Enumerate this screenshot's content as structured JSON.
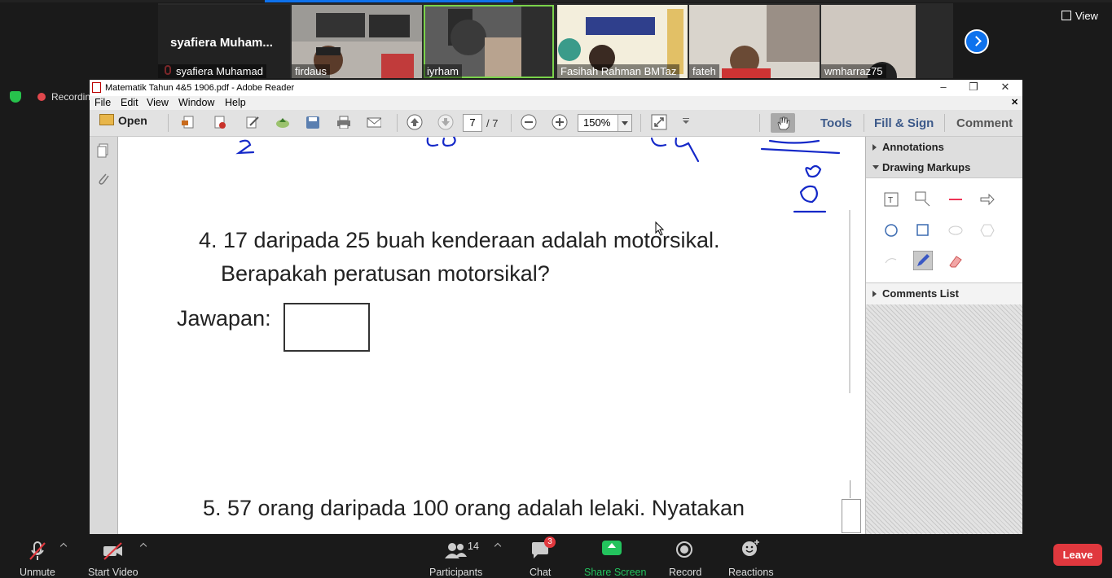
{
  "zoom": {
    "self_name_big": "syafiera  Muham...",
    "participants": [
      {
        "name": "syafiera Muhamad",
        "muted": true
      },
      {
        "name": "firdaus"
      },
      {
        "name": "iyrham",
        "speaking": true
      },
      {
        "name": "Fasihah Rahman BMTaz"
      },
      {
        "name": "fateh"
      },
      {
        "name": "wmharraz75"
      }
    ],
    "view_label": "View",
    "recording_label": "Recording",
    "bottom": {
      "unmute": "Unmute",
      "start_video": "Start Video",
      "participants_label": "Participants",
      "participants_count": "14",
      "chat": "Chat",
      "chat_badge": "3",
      "share_screen": "Share Screen",
      "record": "Record",
      "reactions": "Reactions",
      "leave": "Leave"
    }
  },
  "reader": {
    "title": "Matematik Tahun 4&5 1906.pdf - Adobe Reader",
    "menu": [
      "File",
      "Edit",
      "View",
      "Window",
      "Help"
    ],
    "open_label": "Open",
    "page_current": "7",
    "page_total": "/ 7",
    "zoom": "150%",
    "tools": "Tools",
    "fill_sign": "Fill & Sign",
    "comment": "Comment",
    "panel": {
      "annotations": "Annotations",
      "drawing_markups": "Drawing Markups",
      "comments_list": "Comments List"
    },
    "document": {
      "q4_line1": "4. 17 daripada 25 buah kenderaan adalah motorsikal.",
      "q4_line2": "Berapakah peratusan motorsikal?",
      "answer_label": "Jawapan:",
      "q5_line1": "5.  57 orang daripada 100 orang adalah lelaki. Nyatakan"
    }
  },
  "colors": {
    "zoom_blue": "#0e72ed",
    "share_green": "#23c35d",
    "leave_red": "#e0383e",
    "ink_blue": "#1428c8"
  }
}
